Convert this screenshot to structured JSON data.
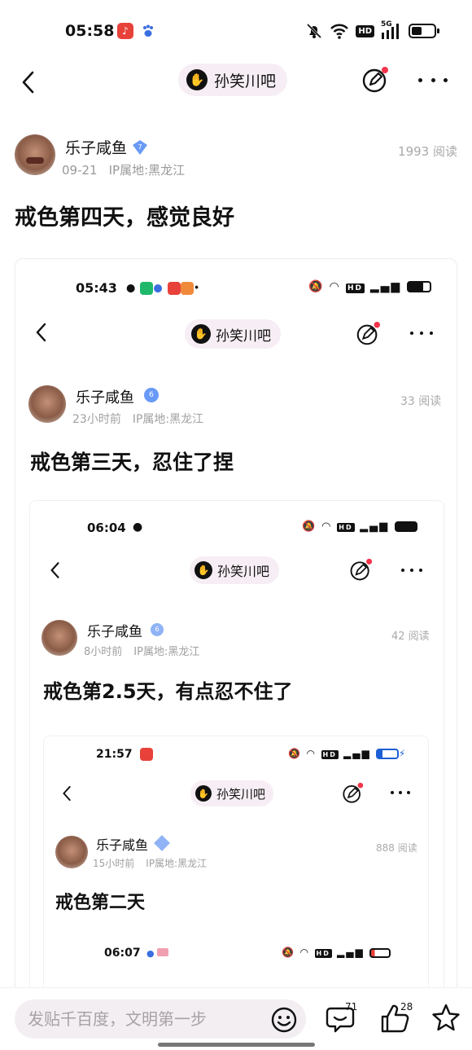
{
  "status_bar": {
    "time": "05:58",
    "network": "5G",
    "hd": "HD"
  },
  "nav": {
    "forum_name": "孙笑川吧"
  },
  "post": {
    "author": "乐子咸鱼",
    "level": "7",
    "date": "09-21",
    "ip_location": "IP属地:黑龙江",
    "reads": "1993 阅读",
    "title": "戒色第四天，感觉良好"
  },
  "nested": [
    {
      "time": "05:43",
      "forum_name": "孙笑川吧",
      "author": "乐子咸鱼",
      "level": "6",
      "date": "23小时前",
      "ip_location": "IP属地:黑龙江",
      "reads": "33 阅读",
      "title": "戒色第三天，忍住了捏"
    },
    {
      "time": "06:04",
      "forum_name": "孙笑川吧",
      "author": "乐子咸鱼",
      "level": "6",
      "date": "8小时前",
      "ip_location": "IP属地:黑龙江",
      "reads": "42 阅读",
      "title": "戒色第2.5天，有点忍不住了"
    },
    {
      "time": "21:57",
      "forum_name": "孙笑川吧",
      "author": "乐子咸鱼",
      "date": "15小时前",
      "ip_location": "IP属地:黑龙江",
      "reads": "888 阅读",
      "title": "戒色第二天"
    },
    {
      "time": "06:07"
    }
  ],
  "bottom_bar": {
    "input_placeholder": "发贴千百度，文明第一步",
    "comment_count": "71",
    "like_count": "28"
  },
  "colors": {
    "accent_red": "#f5344a",
    "level_blue": "#5b8ff9",
    "chip_bg": "#f6eef4"
  }
}
